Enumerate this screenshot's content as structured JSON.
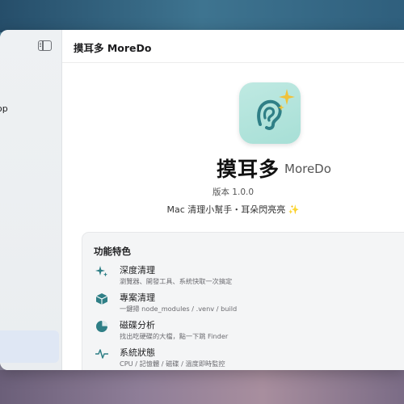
{
  "window": {
    "title": "摸耳多 MoreDo"
  },
  "sidebar": {
    "partial_item": "op"
  },
  "about": {
    "app_name": "摸耳多",
    "app_name_en": "MoreDo",
    "version": "版本 1.0.0",
    "tagline": "Mac 清理小幫手・耳朵閃亮亮",
    "tagline_emoji": "✨"
  },
  "features": {
    "title": "功能特色",
    "items": [
      {
        "icon": "sparkles-icon",
        "name": "深度清理",
        "desc": "瀏覽器、開發工具、系統快取一次搞定"
      },
      {
        "icon": "package-icon",
        "name": "專案清理",
        "desc": "一鍵掃 node_modules / .venv / build"
      },
      {
        "icon": "pie-chart-icon",
        "name": "磁碟分析",
        "desc": "找出吃硬碟的大檔，點一下跳 Finder"
      },
      {
        "icon": "waveform-icon",
        "name": "系統狀態",
        "desc": "CPU / 記憶體 / 磁碟 / 溫度即時監控"
      }
    ]
  },
  "colors": {
    "accent_teal": "#2f7f86",
    "icon_bg": "#b3e4dc",
    "sparkle": "#e7b928"
  }
}
